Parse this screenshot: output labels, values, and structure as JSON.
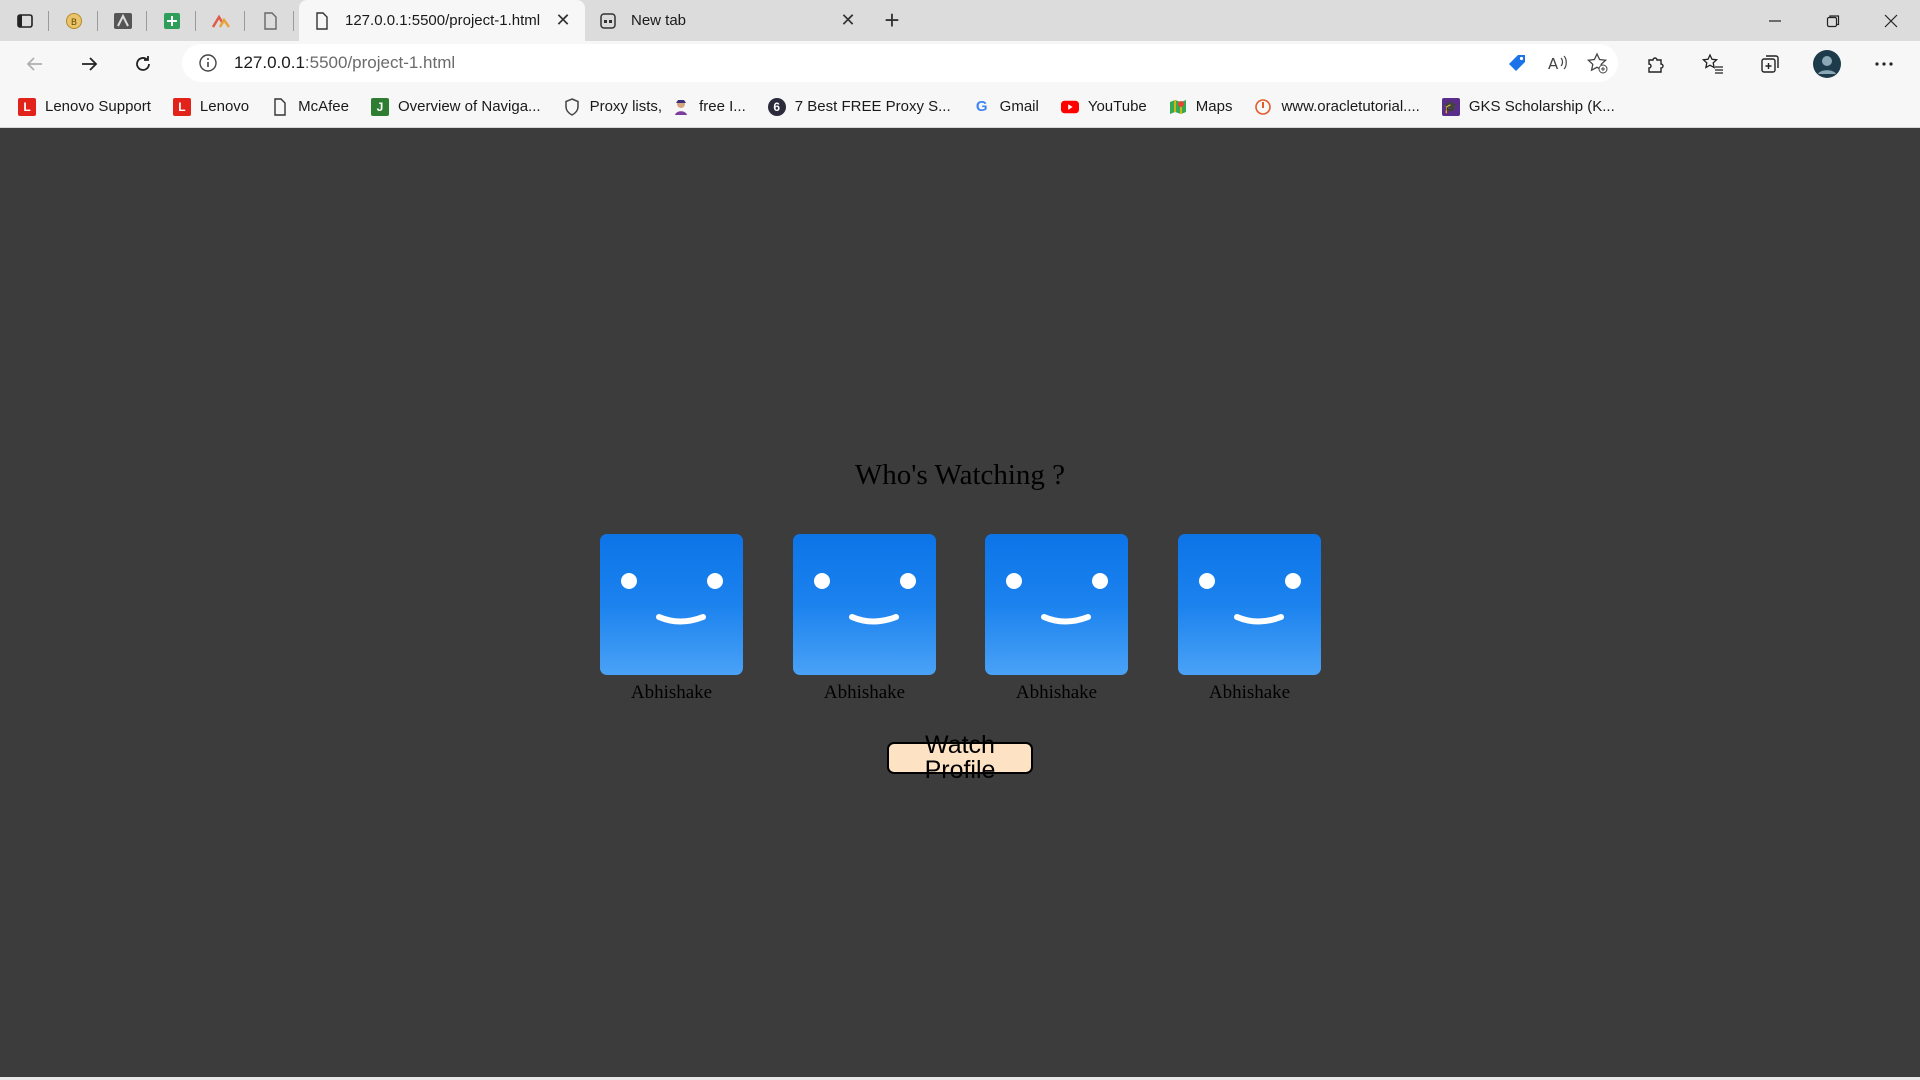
{
  "browser": {
    "pinned_tabs": [
      {
        "icon": "tab-actions-icon"
      },
      {
        "icon": "circle-b-icon"
      },
      {
        "icon": "a-logo-icon"
      },
      {
        "icon": "green-plus-icon"
      },
      {
        "icon": "triangle-logo-icon"
      },
      {
        "icon": "page-icon"
      }
    ],
    "tabs": [
      {
        "title": "127.0.0.1:5500/project-1.html",
        "active": true
      },
      {
        "title": "New tab",
        "active": false
      }
    ],
    "address": {
      "host": "127.0.0.1",
      "rest": ":5500/project-1.html"
    },
    "bookmarks": [
      {
        "label": "Lenovo Support",
        "icon": "lenovo-icon",
        "color": "#e2231a"
      },
      {
        "label": "Lenovo",
        "icon": "lenovo-icon",
        "color": "#e2231a"
      },
      {
        "label": "McAfee",
        "icon": "page-icon",
        "color": "#666666"
      },
      {
        "label": "Overview of Naviga...",
        "icon": "j-icon",
        "color": "#2f7d32"
      },
      {
        "label": "Proxy lists,",
        "icon": "shield-icon",
        "color": "#444444"
      },
      {
        "label": "free I...",
        "icon": "person-icon",
        "color": "#7b3fa0"
      },
      {
        "label": "7 Best FREE Proxy S...",
        "icon": "circle-logo-icon",
        "color": "#2b2b3b"
      },
      {
        "label": "Gmail",
        "icon": "google-icon",
        "color": "#4285f4"
      },
      {
        "label": "YouTube",
        "icon": "youtube-icon",
        "color": "#ff0000"
      },
      {
        "label": "Maps",
        "icon": "maps-icon",
        "color": "#34a853"
      },
      {
        "label": "www.oracletutorial....",
        "icon": "oracle-icon",
        "color": "#e35a2b"
      },
      {
        "label": "GKS Scholarship (K...",
        "icon": "gks-icon",
        "color": "#5b2d8a"
      }
    ]
  },
  "page": {
    "heading": "Who's Watching ?",
    "profiles": [
      {
        "name": "Abhishake"
      },
      {
        "name": "Abhishake"
      },
      {
        "name": "Abhishake"
      },
      {
        "name": "Abhishake"
      }
    ],
    "button_label": "Watch Profile",
    "colors": {
      "background": "#3c3c3c",
      "avatar": "#1b82ee",
      "button": "#fde2c4"
    }
  }
}
